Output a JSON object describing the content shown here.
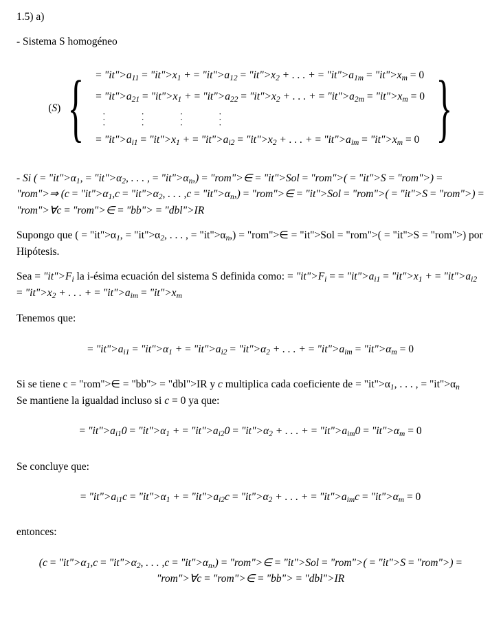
{
  "header": {
    "exercise": "1.5) a)"
  },
  "intro": {
    "sys_line": "- Sistema S homogéneo",
    "s_label_open": "(",
    "s_label_letter": "S",
    "s_label_close": ")",
    "rows": [
      "a₁₁x₁ + a₁₂x₂ + . . . + a₁ₘxₘ = 0",
      "a₂₁x₁ + a₂₂x₂ + . . . + a₂ₘxₘ = 0",
      "aᵢ₁x₁ + aᵢ₂x₂ + . . . + aᵢₘxₘ = 0"
    ]
  },
  "p1": "- Si (α₁,α₂, . . . ,αₙ,) ∈ Sol (S) ⇒ (cα₁,cα₂, . . . ,cαₙ,) ∈ Sol (S) ∀c∈ℝ",
  "p2": "Supongo que (α₁,α₂, . . . ,αₙ,) ∈ Sol (S) por Hipótesis.",
  "p3_a": "Sea ",
  "p3_b": "Fᵢ",
  "p3_c": " la i-ésima ecuación del sistema S definida como: ",
  "p3_d": "Fᵢ = aᵢ₁x₁ + aᵢ₂x₂ + . . . + aᵢₘxₘ",
  "p4": "Tenemos que:",
  "eq1": "aᵢ₁α₁ + aᵢ₂α₂ + . . . + aᵢₘαₘ = 0",
  "p5a": "Si se tiene   c∈ℝ y ",
  "p5a2": "c",
  "p5a3": " multiplica cada coeficiente de α₁, . . . ,αₙ",
  "p5b": "Se mantiene la igualdad incluso si ",
  "p5b2": "c = 0",
  "p5b3": " ya que:",
  "eq2": "aᵢ₁0α₁ + aᵢ₂0α₂ + . . . + aᵢₘ0αₘ = 0",
  "p6": "Se concluye que:",
  "eq3": "aᵢ₁cα₁ + aᵢ₂cα₂ + . . . + aᵢₘcαₘ = 0",
  "p7": "entonces:",
  "eq4": "(cα₁,cα₂, . . . ,cαₙ,) ∈ Sol (S) ∀c∈ℝ"
}
